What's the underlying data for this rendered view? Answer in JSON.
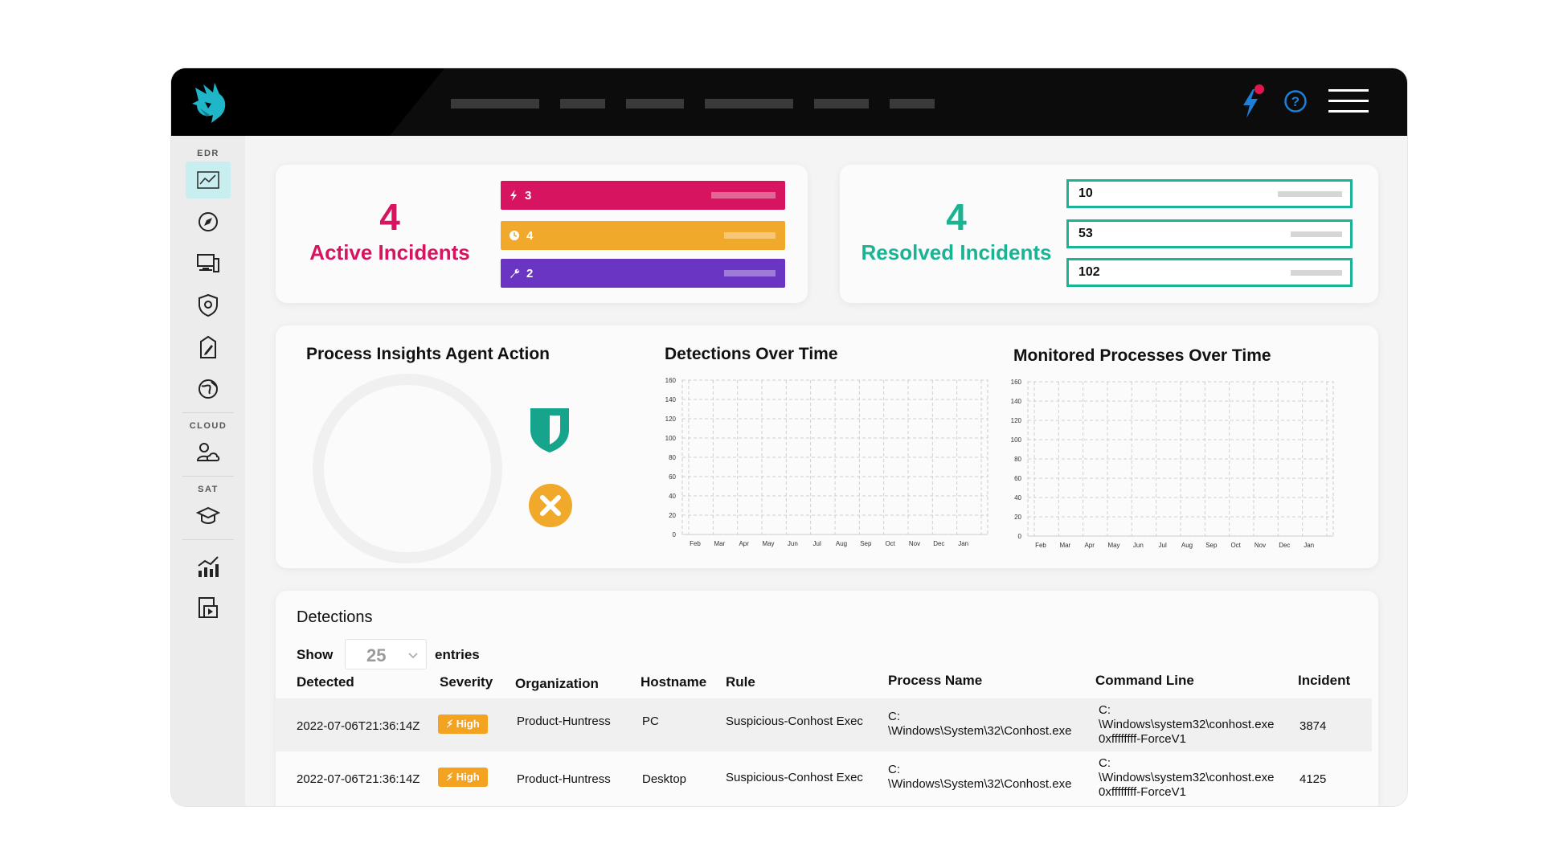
{
  "brand": {
    "accent": "#1fb6c9"
  },
  "nav": {
    "items": [
      "",
      "",
      "",
      "",
      "",
      ""
    ]
  },
  "sidebar": {
    "sections": [
      {
        "label": "EDR",
        "icons": [
          "dashboard-chart-icon",
          "globe-compass-icon",
          "monitor-stack-icon",
          "shield-gear-icon",
          "badge-edit-icon",
          "globe-icon"
        ]
      },
      {
        "label": "CLOUD",
        "icons": [
          "user-cloud-icon"
        ]
      },
      {
        "label": "SAT",
        "icons": [
          "graduation-cap-icon"
        ]
      },
      {
        "label": "",
        "icons": [
          "bar-trend-chart-icon",
          "report-video-icon"
        ]
      }
    ]
  },
  "active_incidents": {
    "count": "4",
    "label": "Active Incidents",
    "color": "#d6145f",
    "bars": [
      {
        "icon": "lightning-icon",
        "value": "3",
        "color": "#d6145f"
      },
      {
        "icon": "clock-icon",
        "value": "4",
        "color": "#f1a92b"
      },
      {
        "icon": "wrench-icon",
        "value": "2",
        "color": "#6a35c2"
      }
    ]
  },
  "resolved_incidents": {
    "count": "4",
    "label": "Resolved Incidents",
    "color": "#1ab394",
    "bars": [
      {
        "value": "10"
      },
      {
        "value": "53"
      },
      {
        "value": "102"
      }
    ]
  },
  "process_insights": {
    "title": "Process Insights Agent Action"
  },
  "detections_chart": {
    "title": "Detections Over Time"
  },
  "monitored_chart": {
    "title": "Monitored Processes Over Time"
  },
  "chart_data": [
    {
      "type": "line",
      "title": "Detections Over Time",
      "x": [
        "Feb",
        "Mar",
        "Apr",
        "May",
        "Jun",
        "Jul",
        "Aug",
        "Sep",
        "Oct",
        "Nov",
        "Dec",
        "Jan"
      ],
      "yticks": [
        "0",
        "20",
        "40",
        "60",
        "80",
        "100",
        "120",
        "140",
        "160"
      ],
      "ylim": [
        0,
        160
      ],
      "grid": true,
      "series": []
    },
    {
      "type": "line",
      "title": "Monitored Processes Over Time",
      "x": [
        "Feb",
        "Mar",
        "Apr",
        "May",
        "Jun",
        "Jul",
        "Aug",
        "Sep",
        "Oct",
        "Nov",
        "Dec",
        "Jan"
      ],
      "yticks": [
        "0",
        "20",
        "40",
        "60",
        "80",
        "100",
        "120",
        "140",
        "160"
      ],
      "ylim": [
        0,
        160
      ],
      "grid": true,
      "series": []
    }
  ],
  "detections": {
    "title": "Detections",
    "show_label": "Show",
    "entries_value": "25",
    "entries_label": "entries",
    "columns": [
      "Detected",
      "Severity",
      "Organization",
      "Hostname",
      "Rule",
      "Process Name",
      "Command Line",
      "Incident"
    ],
    "rows": [
      {
        "detected": "2022-07-06T21:36:14Z",
        "severity": "High",
        "organization": "Product-Huntress",
        "hostname": "PC",
        "rule": "Suspicious-Conhost Exec",
        "process_line1": "C:",
        "process_line2": "\\Windows\\System\\32\\Conhost.exe",
        "cmd_line1": "C:",
        "cmd_line2": "\\Windows\\system32\\conhost.exe",
        "cmd_line3": "0xffffffff-ForceV1",
        "incident": "3874"
      },
      {
        "detected": "2022-07-06T21:36:14Z",
        "severity": "High",
        "organization": "Product-Huntress",
        "hostname": "Desktop",
        "rule": "Suspicious-Conhost Exec",
        "process_line1": "C:",
        "process_line2": "\\Windows\\System\\32\\Conhost.exe",
        "cmd_line1": "C:",
        "cmd_line2": "\\Windows\\system32\\conhost.exe",
        "cmd_line3": "0xffffffff-ForceV1",
        "incident": "4125"
      }
    ]
  }
}
